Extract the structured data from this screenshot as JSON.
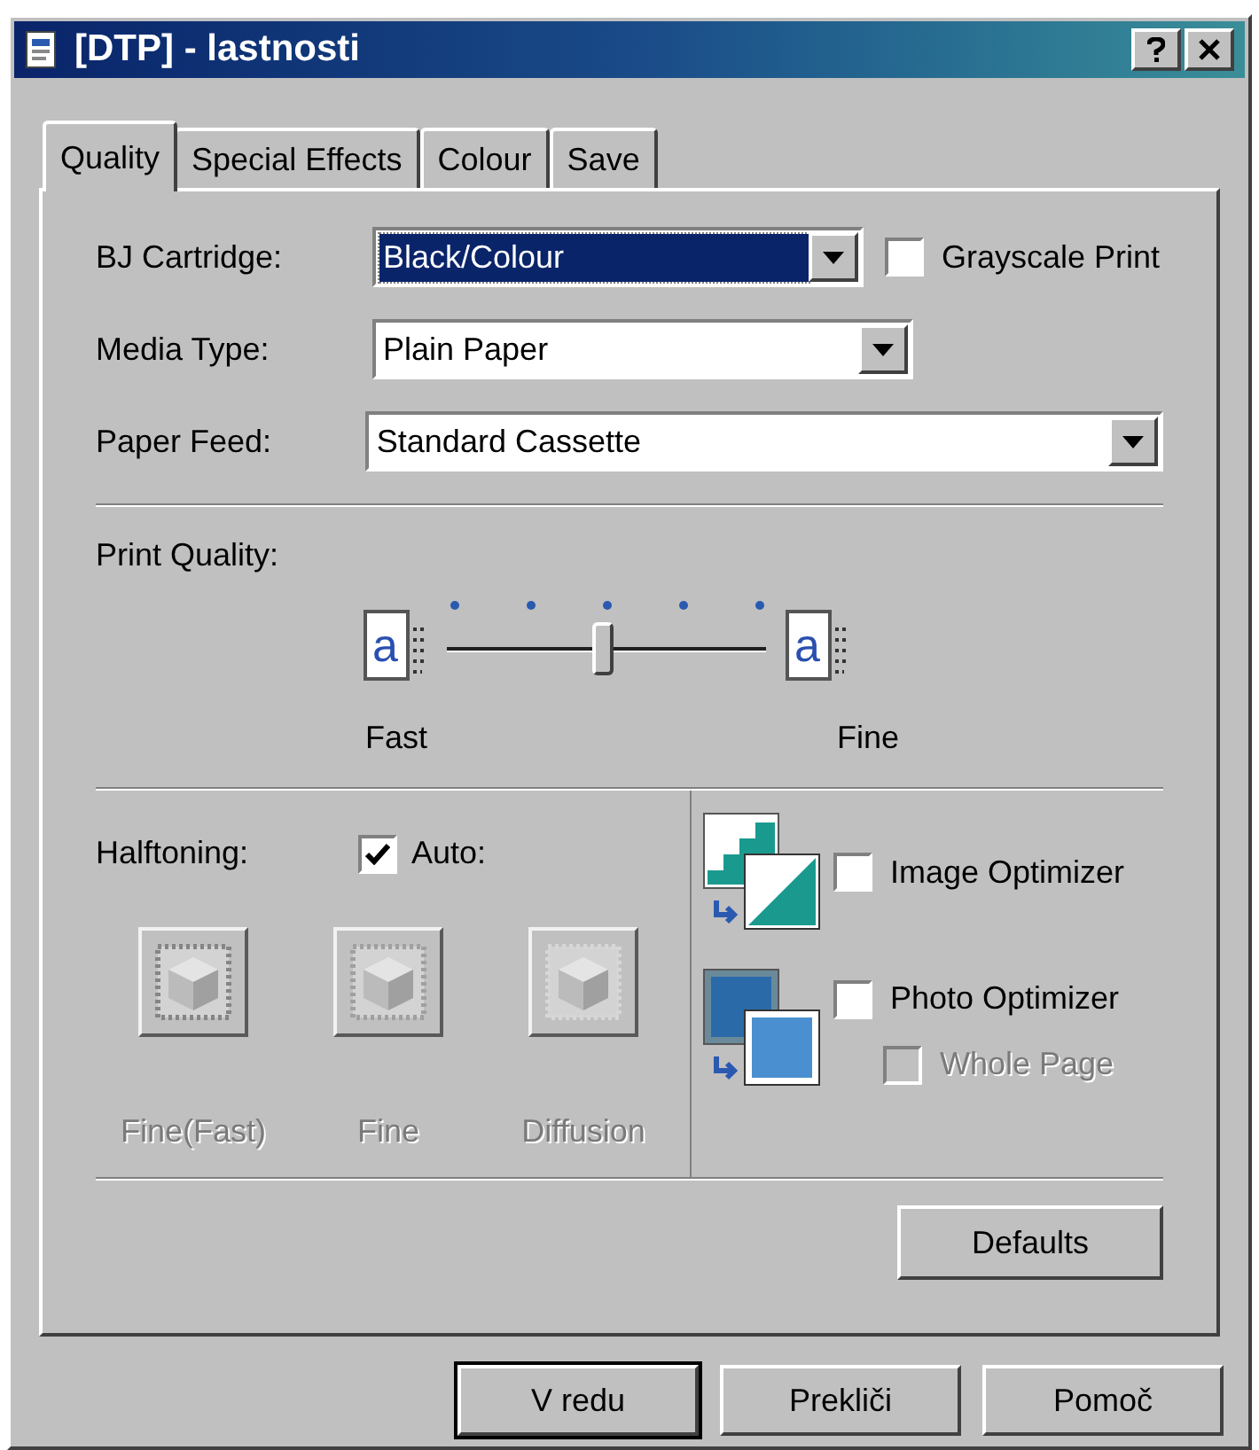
{
  "window": {
    "title": "[DTP] - lastnosti"
  },
  "tabs": [
    {
      "label": "Quality",
      "selected": true
    },
    {
      "label": "Special Effects",
      "selected": false
    },
    {
      "label": "Colour",
      "selected": false
    },
    {
      "label": "Save",
      "selected": false
    }
  ],
  "fields": [
    {
      "label": "BJ Cartridge:",
      "value": "Black/Colour",
      "focused": true
    },
    {
      "label": "Media Type:",
      "value": "Plain Paper",
      "focused": false
    },
    {
      "label": "Paper Feed:",
      "value": "Standard Cassette",
      "focused": false
    }
  ],
  "grayscale_print": {
    "label": "Grayscale Print",
    "checked": false
  },
  "print_quality": {
    "label": "Print Quality:",
    "level": 0.5,
    "left_icon_text": "a",
    "right_icon_text": "a",
    "left_label": "Fast",
    "right_label": "Fine"
  },
  "halftoning": {
    "label": "Halftoning:",
    "auto": {
      "label": "Auto:",
      "checked": true
    },
    "options": [
      {
        "label": "Fine(Fast)",
        "disabled": true
      },
      {
        "label": "Fine",
        "disabled": true
      },
      {
        "label": "Diffusion",
        "disabled": true
      }
    ]
  },
  "image_optimizer": {
    "label": "Image Optimizer",
    "checked": false
  },
  "photo_optimizer": {
    "label": "Photo Optimizer",
    "checked": false
  },
  "whole_page": {
    "label": "Whole Page",
    "checked": false,
    "disabled": true
  },
  "defaults_button": "Defaults",
  "buttons": [
    "V redu",
    "Prekliči",
    "Pomoč"
  ]
}
